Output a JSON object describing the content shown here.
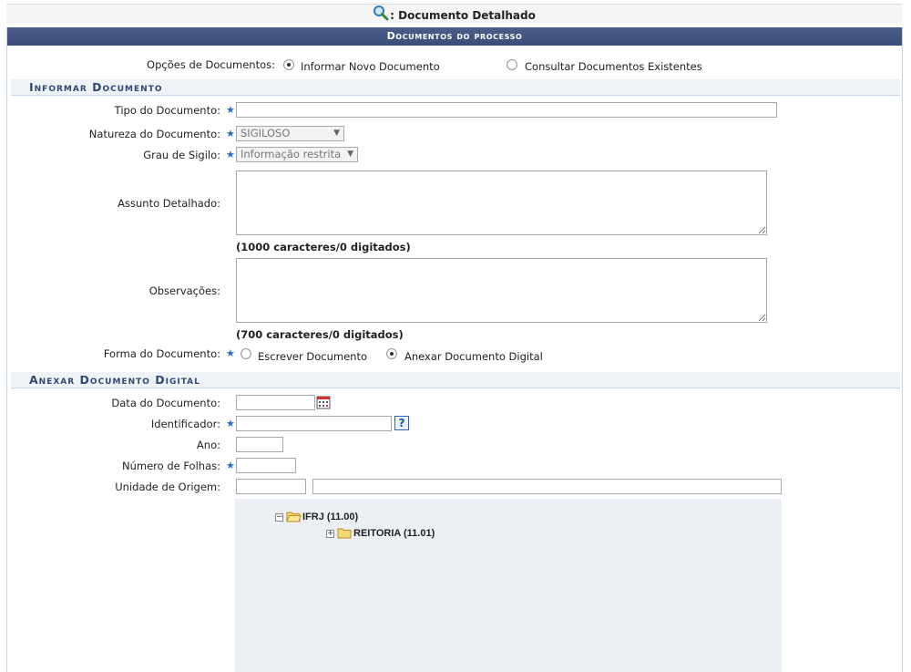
{
  "header": {
    "title": ": Documento Detalhado",
    "icon": "magnifier-icon"
  },
  "caption": "Documentos do processo",
  "options": {
    "label": "Opções de Documentos:",
    "choices": [
      {
        "label": "Informar Novo Documento",
        "checked": true
      },
      {
        "label": "Consultar Documentos Existentes",
        "checked": false
      }
    ]
  },
  "informar": {
    "section_title": "Informar Documento",
    "tipo_label": "Tipo do Documento:",
    "tipo_value": "",
    "natureza_label": "Natureza do Documento:",
    "natureza_value": "SIGILOSO",
    "sigilo_label": "Grau de Sigilo:",
    "sigilo_value": "Informação restrita",
    "assunto_label": "Assunto Detalhado:",
    "assunto_hint": "(1000 caracteres/0 digitados)",
    "obs_label": "Observações:",
    "obs_hint": "(700 caracteres/0 digitados)",
    "forma_label": "Forma do Documento:",
    "forma_choices": [
      {
        "label": "Escrever Documento",
        "checked": false
      },
      {
        "label": "Anexar Documento Digital",
        "checked": true
      }
    ]
  },
  "anexar": {
    "section_title": "Anexar Documento Digital",
    "data_label": "Data do Documento:",
    "identificador_label": "Identificador:",
    "help_glyph": "?",
    "ano_label": "Ano:",
    "folhas_label": "Número de Folhas:",
    "unidade_label": "Unidade de Origem:",
    "tree": [
      {
        "label": "IFRJ (11.00)",
        "expanded": true
      },
      {
        "label": "REITORIA (11.01)",
        "expanded": false
      }
    ]
  },
  "required_mark": "★",
  "colors": {
    "caption_bg": "#3a4d7a",
    "section_bg": "#eef3f8",
    "star": "#2a6cc8"
  }
}
